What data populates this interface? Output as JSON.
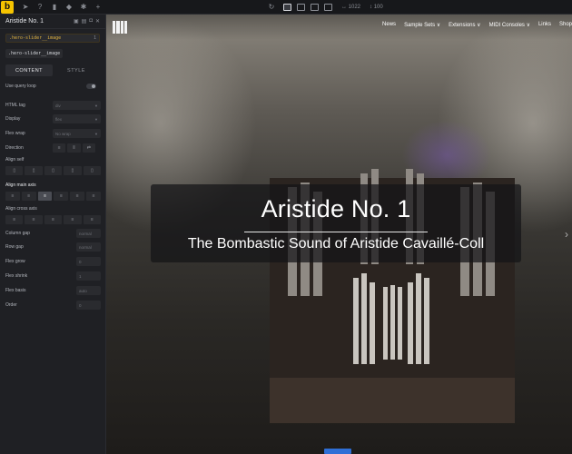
{
  "toolbar": {
    "logo": "b",
    "width_value": "1022",
    "height_value": "100"
  },
  "panel": {
    "element_title": "Aristide No. 1",
    "class_chip": ".hero-slider__image",
    "class_count": "1",
    "class_selected": ".hero-slider__image",
    "tabs": [
      "CONTENT",
      "STYLE"
    ],
    "use_query_loop": "Use query loop",
    "html_tag": {
      "label": "HTML tag",
      "placeholder": "div"
    },
    "display": {
      "label": "Display",
      "placeholder": "flex"
    },
    "flex_wrap": {
      "label": "Flex wrap",
      "placeholder": "No wrap"
    },
    "direction": "Direction",
    "align_self": "Align self",
    "align_main_axis": "Align main axis",
    "align_cross_axis": "Align cross axis",
    "column_gap": {
      "label": "Column gap",
      "placeholder": "normal"
    },
    "row_gap": {
      "label": "Row gap",
      "placeholder": "normal"
    },
    "flex_grow": {
      "label": "Flex grow",
      "placeholder": "0"
    },
    "flex_shrink": {
      "label": "Flex shrink",
      "placeholder": "1"
    },
    "flex_basis": {
      "label": "Flex basis",
      "placeholder": "auto"
    },
    "order": {
      "label": "Order",
      "placeholder": "0"
    }
  },
  "site_nav": {
    "items": [
      "News",
      "Sample Sets ∨",
      "Extensions ∨",
      "MIDI Consoles ∨",
      "Links",
      "Shop"
    ]
  },
  "hero": {
    "title": "Aristide No. 1",
    "subtitle": "The Bombastic Sound of Aristide Cavaillé-Coll"
  },
  "colors": {
    "accent": "#f6c400",
    "panel_bg": "#1f2024",
    "selection": "#2f6fd6"
  }
}
